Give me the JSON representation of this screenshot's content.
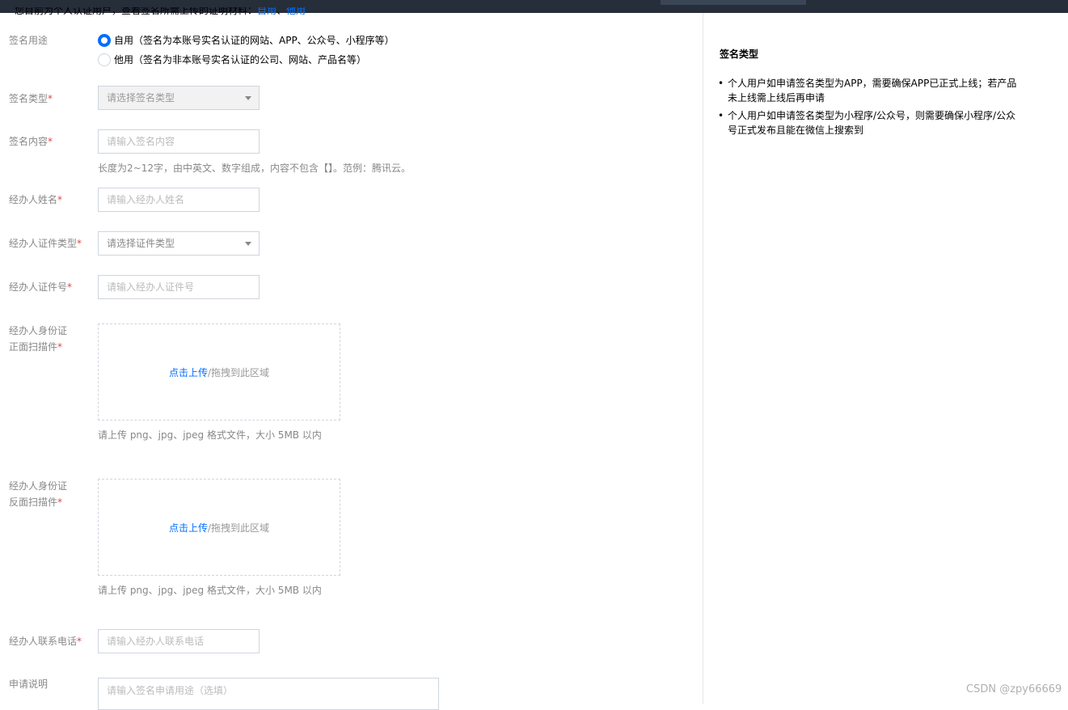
{
  "notice": {
    "text": "您目前为个人认证用户，查看签名所需上传的证明材料：",
    "link_self": "自用",
    "separator": "、",
    "link_other": "他用"
  },
  "form": {
    "purpose": {
      "label": "签名用途",
      "options": [
        {
          "label": "自用（签名为本账号实名认证的网站、APP、公众号、小程序等）",
          "checked": true
        },
        {
          "label": "他用（签名为非本账号实名认证的公司、网站、产品名等）",
          "checked": false
        }
      ]
    },
    "sign_type": {
      "label": "签名类型",
      "placeholder": "请选择签名类型"
    },
    "sign_content": {
      "label": "签名内容",
      "placeholder": "请输入签名内容",
      "hint": "长度为2~12字，由中英文、数字组成，内容不包含【】。范例：腾讯云。"
    },
    "agent_name": {
      "label": "经办人姓名",
      "placeholder": "请输入经办人姓名"
    },
    "agent_id_type": {
      "label": "经办人证件类型",
      "placeholder": "请选择证件类型"
    },
    "agent_id_number": {
      "label": "经办人证件号",
      "placeholder": "请输入经办人证件号"
    },
    "id_front": {
      "label_line1": "经办人身份证",
      "label_line2": "正面扫描件",
      "upload_link": "点击上传",
      "upload_rest": "/拖拽到此区域",
      "hint": "请上传 png、jpg、jpeg 格式文件，大小 5MB 以内"
    },
    "id_back": {
      "label_line1": "经办人身份证",
      "label_line2": "反面扫描件",
      "upload_link": "点击上传",
      "upload_rest": "/拖拽到此区域",
      "hint": "请上传 png、jpg、jpeg 格式文件，大小 5MB 以内"
    },
    "agent_phone": {
      "label": "经办人联系电话",
      "placeholder": "请输入经办人联系电话"
    },
    "application_note": {
      "label": "申请说明",
      "placeholder": "请输入签名申请用途（选填）"
    },
    "required_mark": "*"
  },
  "sidebar": {
    "title": "签名类型",
    "items": [
      "个人用户如申请签名类型为APP，需要确保APP已正式上线；若产品未上线需上线后再申请",
      "个人用户如申请签名类型为小程序/公众号，则需要确保小程序/公众号正式发布且能在微信上搜索到"
    ]
  },
  "watermark": "CSDN @zpy66669",
  "colors": {
    "accent": "#006eff",
    "required": "#e54545",
    "topbar": "#262e3a"
  }
}
